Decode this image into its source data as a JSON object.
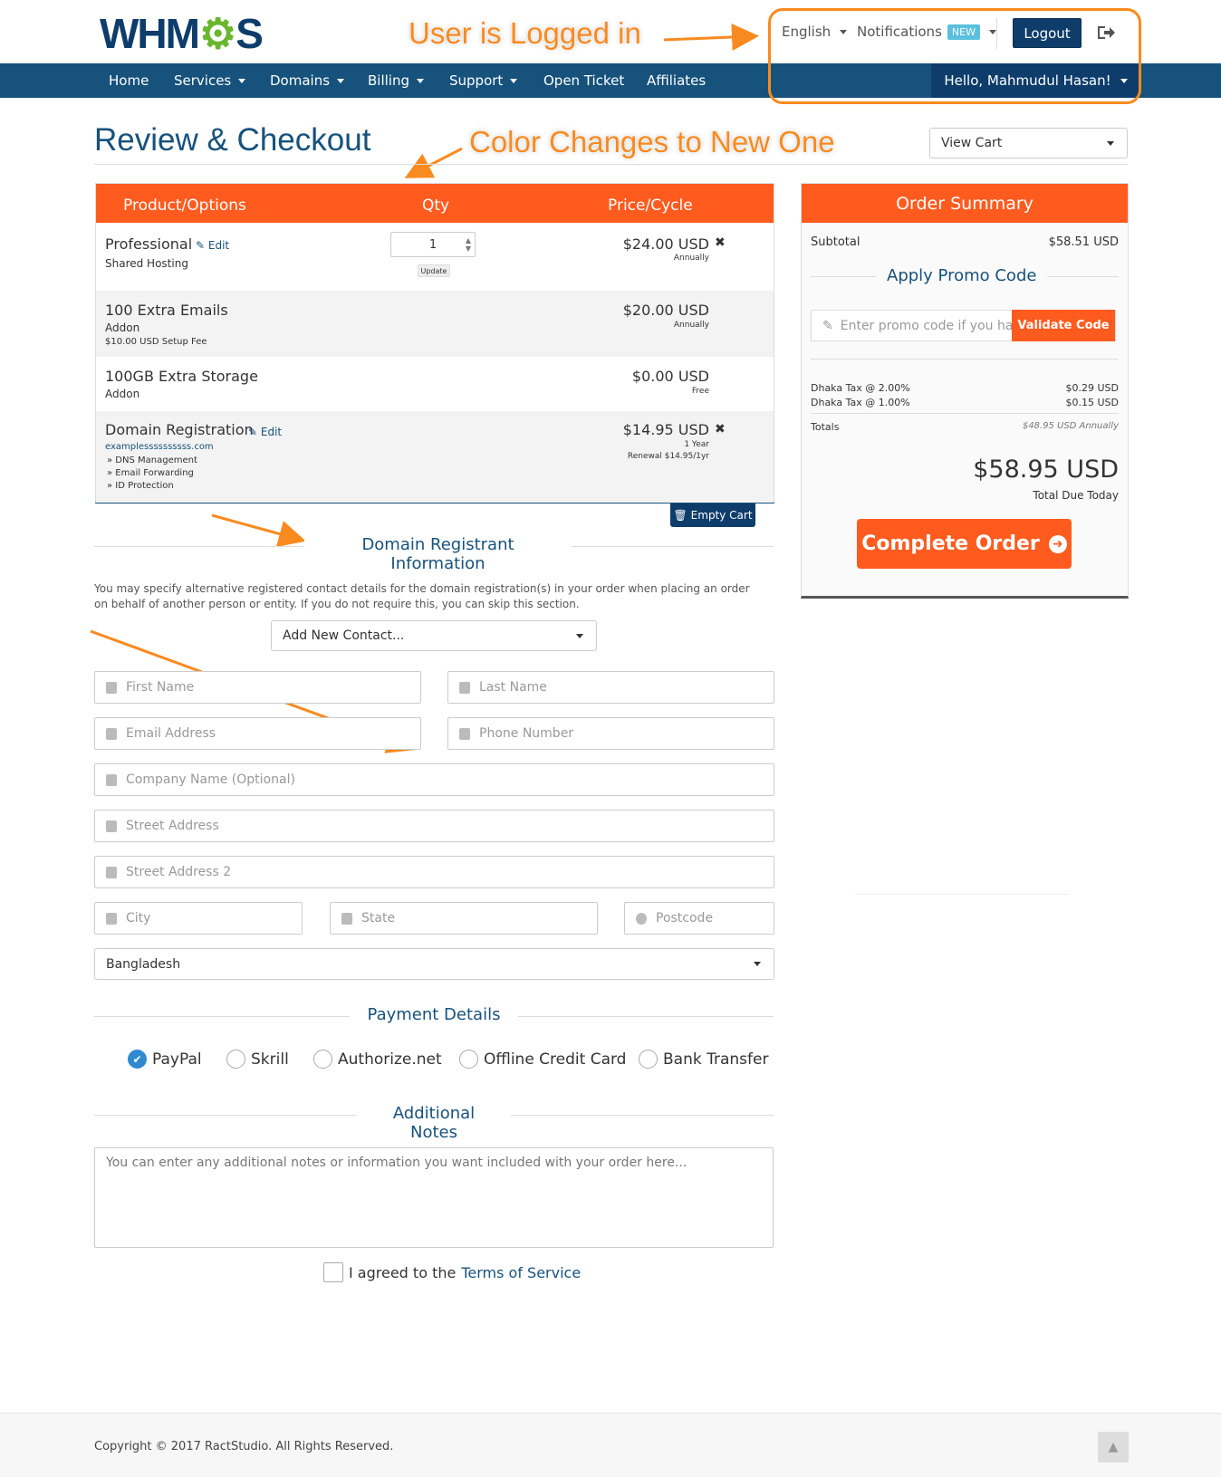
{
  "brand": {
    "logo_text_a": "WHM",
    "logo_gear": "⚙",
    "logo_text_b": "S"
  },
  "topbar": {
    "language": "English",
    "notifications": "Notifications",
    "notif_badge": "NEW",
    "logout": "Logout"
  },
  "nav": {
    "items": [
      "Home",
      "Services",
      "Domains",
      "Billing",
      "Support",
      "Open Ticket",
      "Affiliates"
    ],
    "user": "Hello, Mahmudul Hasan!"
  },
  "annotations": {
    "logged_in": "User is Logged in",
    "color_change": "Color Changes to New One"
  },
  "page": {
    "title": "Review & Checkout",
    "view_cart": "View Cart"
  },
  "cart": {
    "headers": {
      "product": "Product/Options",
      "qty": "Qty",
      "price": "Price/Cycle"
    },
    "edit": "Edit",
    "update": "Update",
    "qty_value": "1",
    "empty_cart": "Empty Cart",
    "items": [
      {
        "name": "Professional",
        "sub": "Shared Hosting",
        "price": "$24.00 USD",
        "cycle": "Annually"
      },
      {
        "name": "100 Extra Emails",
        "sub": "Addon",
        "fee": "$10.00 USD Setup Fee",
        "price": "$20.00 USD",
        "cycle": "Annually"
      },
      {
        "name": "100GB Extra Storage",
        "sub": "Addon",
        "price": "$0.00 USD",
        "cycle": "Free"
      },
      {
        "name": "Domain Registration",
        "domain": "examplessssssssss.com",
        "opts": [
          "» DNS Management",
          "» Email Forwarding",
          "» ID Protection"
        ],
        "price": "$14.95 USD",
        "cycle": "1 Year",
        "renewal": "Renewal $14.95/1yr"
      }
    ]
  },
  "registrant": {
    "heading": "Domain Registrant Information",
    "desc": "You may specify alternative registered contact details for the domain registration(s) in your order when placing an order on behalf of another person or entity. If you do not require this, you can skip this section.",
    "contact_select": "Add New Contact...",
    "placeholders": {
      "first": "First Name",
      "last": "Last Name",
      "email": "Email Address",
      "phone": "Phone Number",
      "company": "Company Name (Optional)",
      "street": "Street Address",
      "street2": "Street Address 2",
      "city": "City",
      "state": "State",
      "postcode": "Postcode"
    },
    "country": "Bangladesh"
  },
  "payment": {
    "heading": "Payment Details",
    "options": [
      "PayPal",
      "Skrill",
      "Authorize.net",
      "Offline Credit Card",
      "Bank Transfer"
    ],
    "selected": "PayPal"
  },
  "notes": {
    "heading": "Additional Notes",
    "placeholder": "You can enter any additional notes or information you want included with your order here..."
  },
  "tos": {
    "text": "I agreed to the",
    "link": "Terms of Service"
  },
  "summary": {
    "heading": "Order Summary",
    "subtotal_label": "Subtotal",
    "subtotal": "$58.51 USD",
    "promo_heading": "Apply Promo Code",
    "promo_placeholder": "Enter promo code if you have one",
    "validate": "Validate Code",
    "taxes": [
      {
        "label": "Dhaka Tax @ 2.00%",
        "value": "$0.29 USD"
      },
      {
        "label": "Dhaka Tax @ 1.00%",
        "value": "$0.15 USD"
      }
    ],
    "totals_label": "Totals",
    "totals_value": "$48.95 USD Annually",
    "total": "$58.95 USD",
    "due_label": "Total Due Today",
    "complete": "Complete Order"
  },
  "footer": {
    "copyright": "Copyright © 2017 RactStudio. All Rights Reserved."
  },
  "colors": {
    "primary": "#16527c",
    "accent": "#ff5b1f",
    "annotation": "#f98a1f"
  }
}
